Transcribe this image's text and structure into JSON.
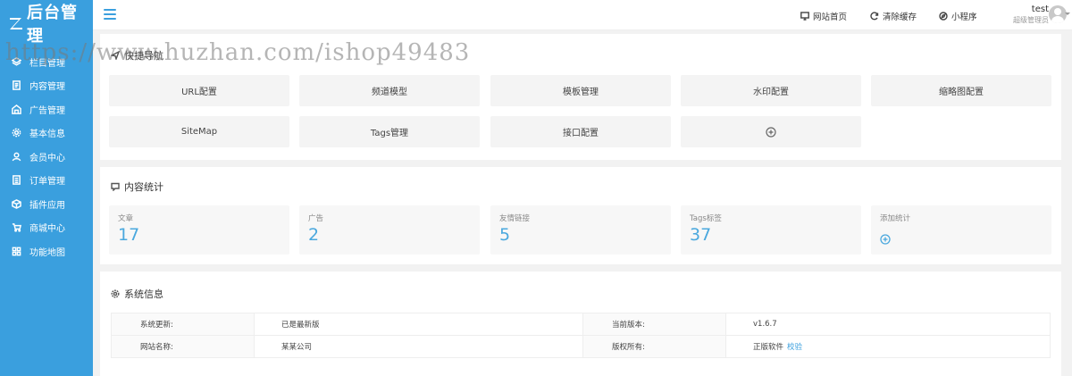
{
  "app": {
    "logo_text": "后台管理"
  },
  "sidebar": {
    "items": [
      {
        "label": "栏目管理",
        "icon": "layers-icon"
      },
      {
        "label": "内容管理",
        "icon": "document-icon"
      },
      {
        "label": "广告管理",
        "icon": "ad-icon"
      },
      {
        "label": "基本信息",
        "icon": "gear-icon"
      },
      {
        "label": "会员中心",
        "icon": "user-icon"
      },
      {
        "label": "订单管理",
        "icon": "order-icon"
      },
      {
        "label": "插件应用",
        "icon": "cube-icon"
      },
      {
        "label": "商城中心",
        "icon": "cart-icon"
      },
      {
        "label": "功能地图",
        "icon": "grid-icon"
      }
    ]
  },
  "header": {
    "links": [
      {
        "label": "网站首页",
        "icon": "monitor-icon"
      },
      {
        "label": "清除缓存",
        "icon": "refresh-icon"
      },
      {
        "label": "小程序",
        "icon": "compass-icon"
      }
    ],
    "user_name": "test",
    "user_role": "超级管理员"
  },
  "quick": {
    "title": "快捷导航",
    "buttons": [
      "URL配置",
      "频道模型",
      "模板管理",
      "水印配置",
      "缩略图配置",
      "SiteMap",
      "Tags管理",
      "接口配置"
    ]
  },
  "stats": {
    "title": "内容统计",
    "items": [
      {
        "label": "文章",
        "value": "17"
      },
      {
        "label": "广告",
        "value": "2"
      },
      {
        "label": "友情链接",
        "value": "5"
      },
      {
        "label": "Tags标签",
        "value": "37"
      }
    ],
    "add_label": "添加统计"
  },
  "sysinfo": {
    "title": "系统信息",
    "rows": [
      {
        "k1": "系统更新:",
        "v1": "已是最新版",
        "k2": "当前版本:",
        "v2": "v1.6.7"
      },
      {
        "k1": "网站名称:",
        "v1": "某某公司",
        "k2": "版权所有:",
        "v2": "正版软件",
        "link": "校验"
      }
    ]
  },
  "watermark": "https://www.huzhan.com/ishop49483",
  "colors": {
    "accent": "#3a9fde",
    "stat_value": "#4aa8de"
  }
}
